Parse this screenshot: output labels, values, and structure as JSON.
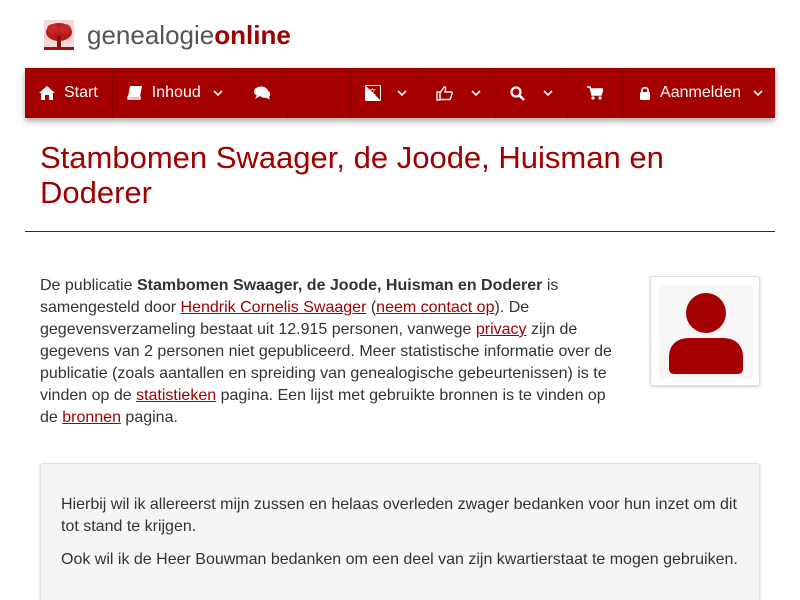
{
  "logo": {
    "text_plain": "genealogie",
    "text_accent": "online",
    "icon": "tree-icon"
  },
  "navbar": {
    "start": {
      "label": "Start",
      "icon": "home-icon"
    },
    "inhoud": {
      "label": "Inhoud",
      "icon": "book-icon"
    },
    "chat_icon": "comments-icon",
    "language_icon": "language-icon",
    "share_icon": "thumbs-up-icon",
    "search_icon": "search-icon",
    "cart_icon": "shopping-cart-icon",
    "login": {
      "label": "Aanmelden",
      "icon": "lock-icon"
    }
  },
  "page": {
    "title": "Stambomen Swaager, de Joode, Huisman en Doderer"
  },
  "intro": {
    "t1": "De publicatie ",
    "pub_name": "Stambomen Swaager, de Joode, Huisman en Doderer",
    "t2": " is samengesteld door ",
    "author_link": "Hendrik Cornelis Swaager",
    "t3": " (",
    "contact_link": "neem contact op",
    "t4": "). De gegevensverzameling bestaat uit 12.915 personen, vanwege ",
    "privacy_link": "privacy",
    "t5": " zijn de gegevens van 2 personen niet gepubliceerd. Meer statistische informatie over de publicatie (zoals aantallen en spreiding van genealogische gebeurtenissen) is te vinden op de ",
    "stats_link": "statistieken",
    "t6": " pagina. Een lijst met gebruikte bronnen is te vinden op de ",
    "sources_link": "bronnen",
    "t7": " pagina."
  },
  "avatar": {
    "icon": "user-icon"
  },
  "card": {
    "p1": "Hierbij wil ik allereerst mijn zussen en helaas overleden zwager bedanken voor hun inzet om dit tot stand te krijgen.",
    "p2": "Ook wil ik de Heer Bouwman bedanken om een deel van zijn kwartierstaat te mogen gebruiken."
  },
  "colors": {
    "brand": "#a50000",
    "link": "#a00000",
    "text": "#333333"
  }
}
